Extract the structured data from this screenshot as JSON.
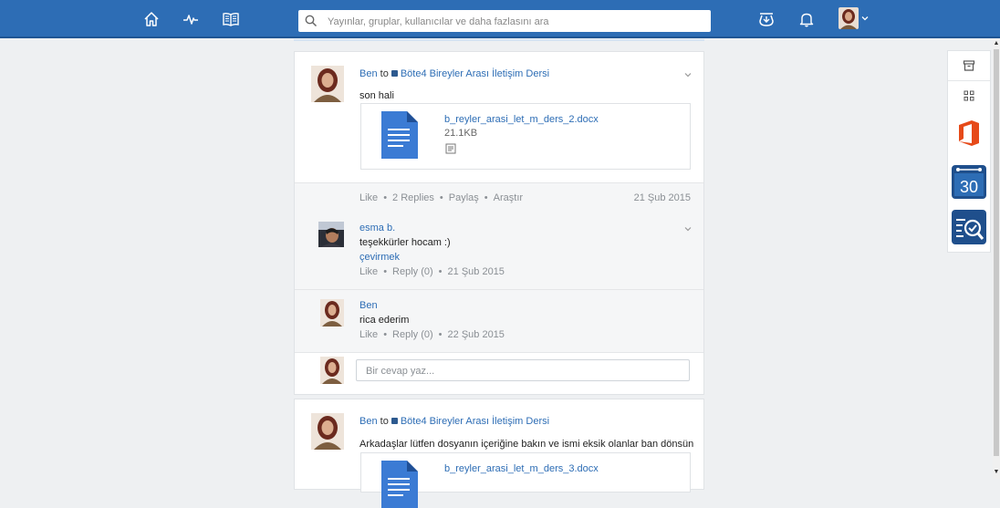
{
  "topbar": {
    "search_placeholder": "Yayınlar, gruplar, kullanıcılar ve daha fazlasını ara",
    "nav_icons": [
      "home-icon",
      "activity-icon",
      "book-icon"
    ],
    "right_icons": [
      "inbox-icon",
      "bell-icon"
    ],
    "accent_color": "#2d6db5"
  },
  "post1": {
    "author": "Ben",
    "to": "to",
    "group": "Böte4 Bireyler Arası İletişim Dersi",
    "message": "son hali",
    "attachment": {
      "name": "b_reyler_arasi_let_m_ders_2.docx",
      "size": "21.1KB"
    },
    "actions": {
      "like": "Like",
      "replies": "2 Replies",
      "share": "Paylaş",
      "search": "Araştır"
    },
    "date": "21 Şub 2015",
    "replies": [
      {
        "author": "esma b.",
        "text": "teşekkürler hocam :)",
        "translate": "çevirmek",
        "like": "Like",
        "reply": "Reply (0)",
        "date": "21 Şub 2015"
      },
      {
        "author": "Ben",
        "text": "rica ederim",
        "like": "Like",
        "reply": "Reply (0)",
        "date": "22 Şub 2015"
      }
    ],
    "reply_placeholder": "Bir cevap yaz..."
  },
  "post2": {
    "author": "Ben",
    "to": "to",
    "group": "Böte4 Bireyler Arası İletişim Dersi",
    "message": "Arkadaşlar lütfen dosyanın içeriğine bakın ve ismi eksik olanlar ban dönsün",
    "attachment": {
      "name": "b_reyler_arasi_let_m_ders_3.docx"
    }
  },
  "siderail": {
    "items": [
      "archive-icon",
      "apps-grid-icon",
      "office-icon",
      "calendar-icon",
      "search-tasks-icon"
    ],
    "calendar_day": "30"
  }
}
